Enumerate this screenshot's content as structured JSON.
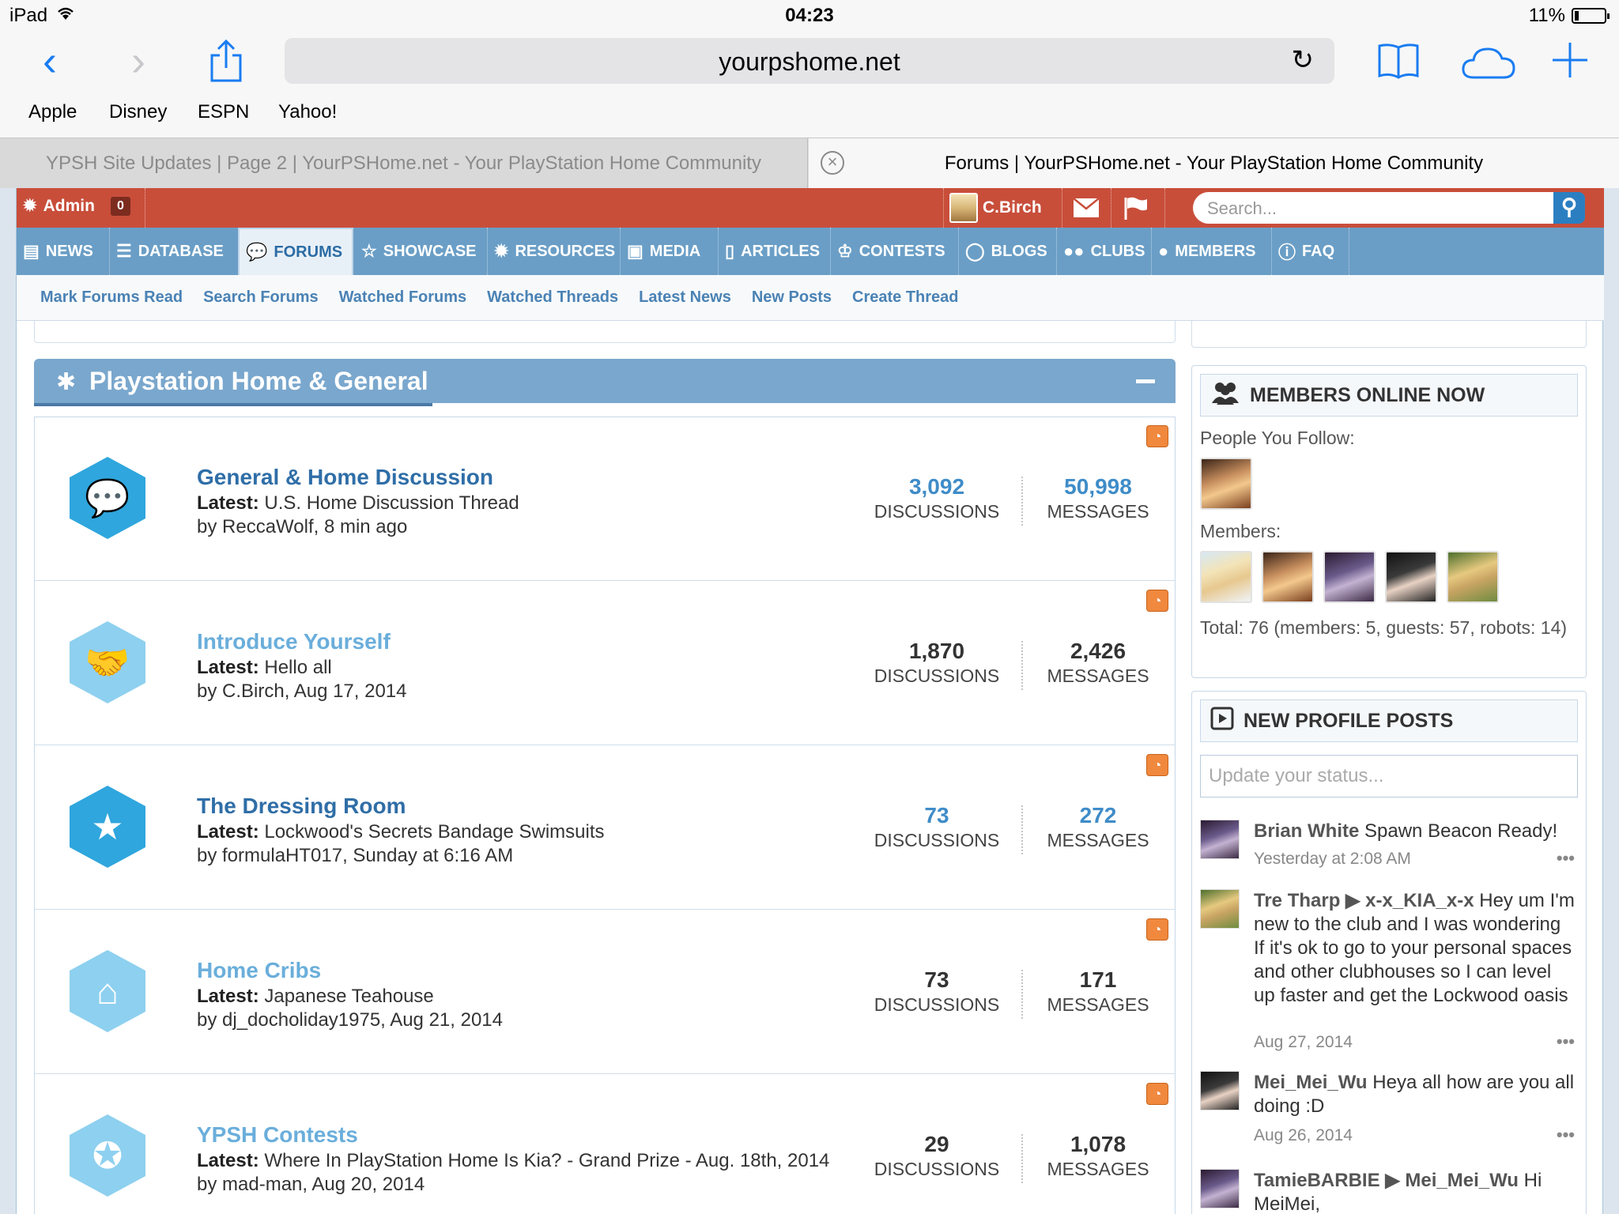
{
  "status_bar": {
    "device": "iPad",
    "time": "04:23",
    "battery": "11%"
  },
  "browser": {
    "url": "yourpshome.net",
    "bookmarks": [
      "Apple",
      "Disney",
      "ESPN",
      "Yahoo!"
    ],
    "tabs": [
      {
        "title": "YPSH Site Updates | Page 2 | YourPSHome.net - Your PlayStation Home Community",
        "active": false
      },
      {
        "title": "Forums | YourPSHome.net - Your PlayStation Home Community",
        "active": true
      }
    ]
  },
  "admin_bar": {
    "label": "Admin",
    "count": "0",
    "username": "C.Birch",
    "search_placeholder": "Search..."
  },
  "main_nav": [
    {
      "label": "NEWS",
      "icon": "newspaper-icon"
    },
    {
      "label": "DATABASE",
      "icon": "database-icon"
    },
    {
      "label": "FORUMS",
      "icon": "chat-bubbles-icon",
      "active": true
    },
    {
      "label": "SHOWCASE",
      "icon": "star-icon"
    },
    {
      "label": "RESOURCES",
      "icon": "gear-icon"
    },
    {
      "label": "MEDIA",
      "icon": "image-icon"
    },
    {
      "label": "ARTICLES",
      "icon": "document-icon"
    },
    {
      "label": "CONTESTS",
      "icon": "trophy-icon"
    },
    {
      "label": "BLOGS",
      "icon": "speech-bubble-icon"
    },
    {
      "label": "CLUBS",
      "icon": "group-icon"
    },
    {
      "label": "MEMBERS",
      "icon": "user-icon"
    },
    {
      "label": "FAQ",
      "icon": "info-icon"
    }
  ],
  "sub_nav": [
    "Mark Forums Read",
    "Search Forums",
    "Watched Forums",
    "Watched Threads",
    "Latest News",
    "New Posts",
    "Create Thread"
  ],
  "category": {
    "title": "Playstation Home & General"
  },
  "forums": [
    {
      "name": "General & Home Discussion",
      "latest_label": "Latest:",
      "latest": "U.S. Home Discussion Thread",
      "by": "by ReccaWolf, 8 min ago",
      "discussions": "3,092",
      "messages": "50,998",
      "unread": true,
      "icon": "chat-bubbles-icon"
    },
    {
      "name": "Introduce Yourself",
      "latest_label": "Latest:",
      "latest": "Hello all",
      "by": "by C.Birch, Aug 17, 2014",
      "discussions": "1,870",
      "messages": "2,426",
      "unread": false,
      "icon": "handshake-icon"
    },
    {
      "name": "The Dressing Room",
      "latest_label": "Latest:",
      "latest": "Lockwood's Secrets Bandage Swimsuits",
      "by": "by formulaHT017, Sunday at 6:16 AM",
      "discussions": "73",
      "messages": "272",
      "unread": true,
      "icon": "mannequin-star-icon"
    },
    {
      "name": "Home Cribs",
      "latest_label": "Latest:",
      "latest": "Japanese Teahouse",
      "by": "by dj_docholiday1975, Aug 21, 2014",
      "discussions": "73",
      "messages": "171",
      "unread": false,
      "icon": "house-icon"
    },
    {
      "name": "YPSH Contests",
      "latest_label": "Latest:",
      "latest": "Where In PlayStation Home Is Kia? - Grand Prize - Aug. 18th, 2014",
      "by": "by mad-man, Aug 20, 2014",
      "discussions": "29",
      "messages": "1,078",
      "unread": false,
      "icon": "ribbon-icon"
    }
  ],
  "stat_labels": {
    "discussions": "DISCUSSIONS",
    "messages": "MESSAGES"
  },
  "members_online": {
    "title": "MEMBERS ONLINE NOW",
    "follow_label": "People You Follow:",
    "members_label": "Members:",
    "total": "Total: 76 (members: 5, guests: 57, robots: 14)"
  },
  "profile_posts": {
    "title": "NEW PROFILE POSTS",
    "status_placeholder": "Update your status...",
    "posts": [
      {
        "author": "Brian White",
        "text": " Spawn Beacon Ready!",
        "date": "Yesterday at 2:08 AM"
      },
      {
        "author": "Tre Tharp ▶ x-x_KIA_x-x",
        "text": " Hey um I'm new to the club and I was wondering If it's ok to go to your personal spaces and other clubhouses so I can level up faster and get the Lockwood oasis",
        "date": "Aug 27, 2014"
      },
      {
        "author": "Mei_Mei_Wu",
        "text": " Heya all how are you all doing :D",
        "date": "Aug 26, 2014"
      },
      {
        "author": "TamieBARBIE ▶ Mei_Mei_Wu",
        "text": " Hi MeiMei,",
        "date": ""
      }
    ],
    "more": "•••"
  },
  "colors": {
    "admin_bar": "#c84e3a",
    "nav": "#6a9ec6",
    "link": "#2f6ea7",
    "ios_blue": "#1a7cf2"
  }
}
